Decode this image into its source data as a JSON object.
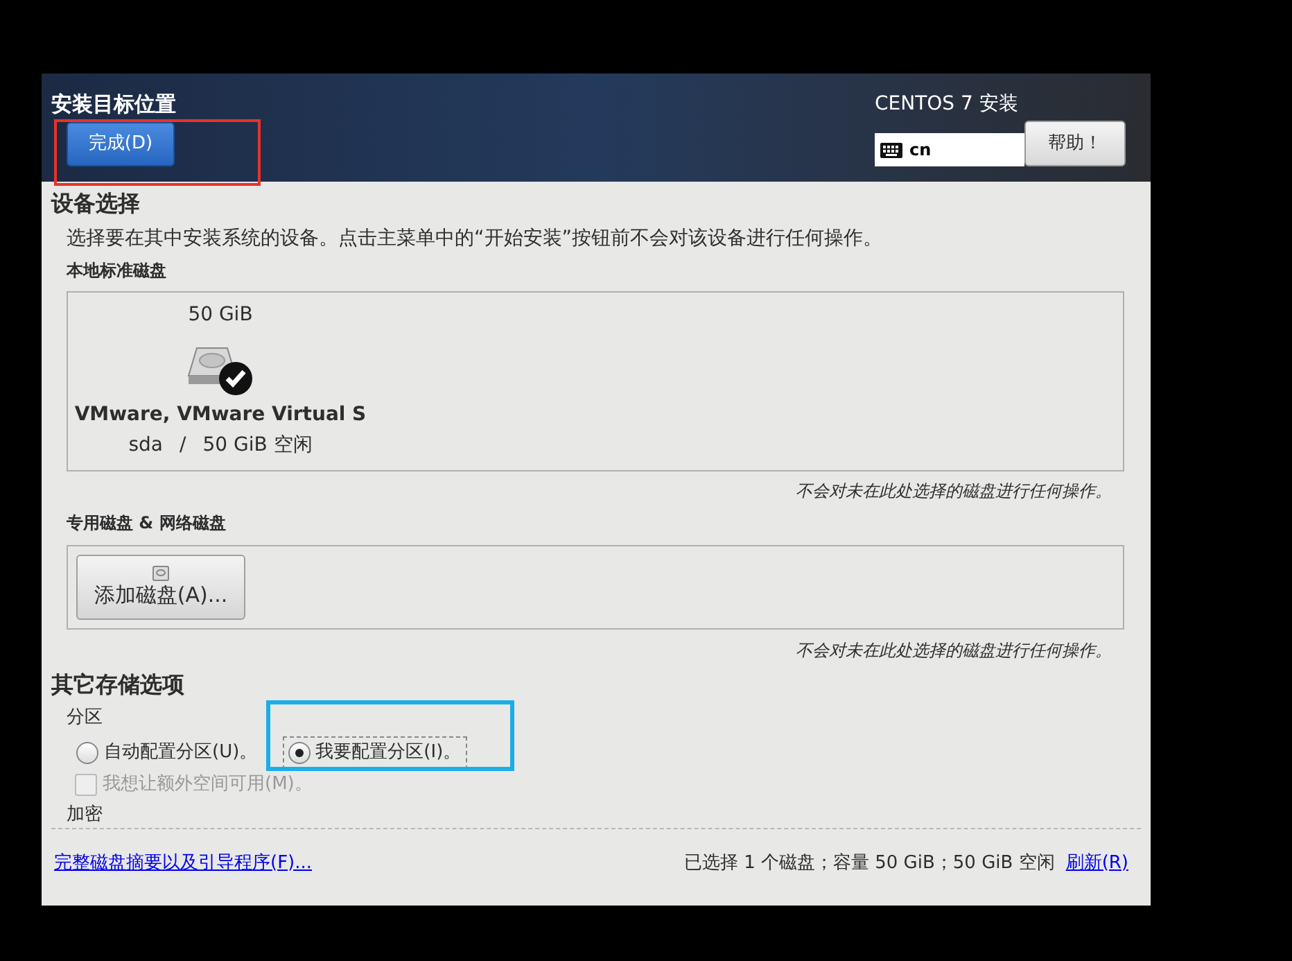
{
  "header": {
    "title": "安装目标位置",
    "done_button": "完成(D)",
    "product": "CENTOS 7 安装",
    "keyboard_layout": "cn",
    "help_button": "帮助！"
  },
  "device_selection": {
    "heading": "设备选择",
    "description": "选择要在其中安装系统的设备。点击主菜单中的“开始安装”按钮前不会对该设备进行任何操作。",
    "local_disks": {
      "heading": "本地标准磁盘",
      "disks": [
        {
          "size": "50 GiB",
          "name": "VMware, VMware Virtual S",
          "device": "sda",
          "separator": "/",
          "free": "50 GiB 空闲",
          "selected": true
        }
      ],
      "note": "不会对未在此处选择的磁盘进行任何操作。"
    },
    "special_disks": {
      "heading": "专用磁盘 & 网络磁盘",
      "add_button": "添加磁盘(A)...",
      "note": "不会对未在此处选择的磁盘进行任何操作。"
    }
  },
  "other_options": {
    "heading": "其它存储选项",
    "partitioning": {
      "heading": "分区",
      "options": [
        {
          "label": "自动配置分区(U)。",
          "selected": false
        },
        {
          "label": "我要配置分区(I)。",
          "selected": true
        }
      ],
      "extra_space": {
        "label": "我想让额外空间可用(M)。",
        "checked": false,
        "disabled": true
      }
    },
    "encryption_heading": "加密"
  },
  "footer": {
    "summary_link": "完整磁盘摘要以及引导程序(F)...",
    "status": "已选择 1 个磁盘；容量 50 GiB；50 GiB 空闲",
    "refresh_link": "刷新(R)"
  }
}
